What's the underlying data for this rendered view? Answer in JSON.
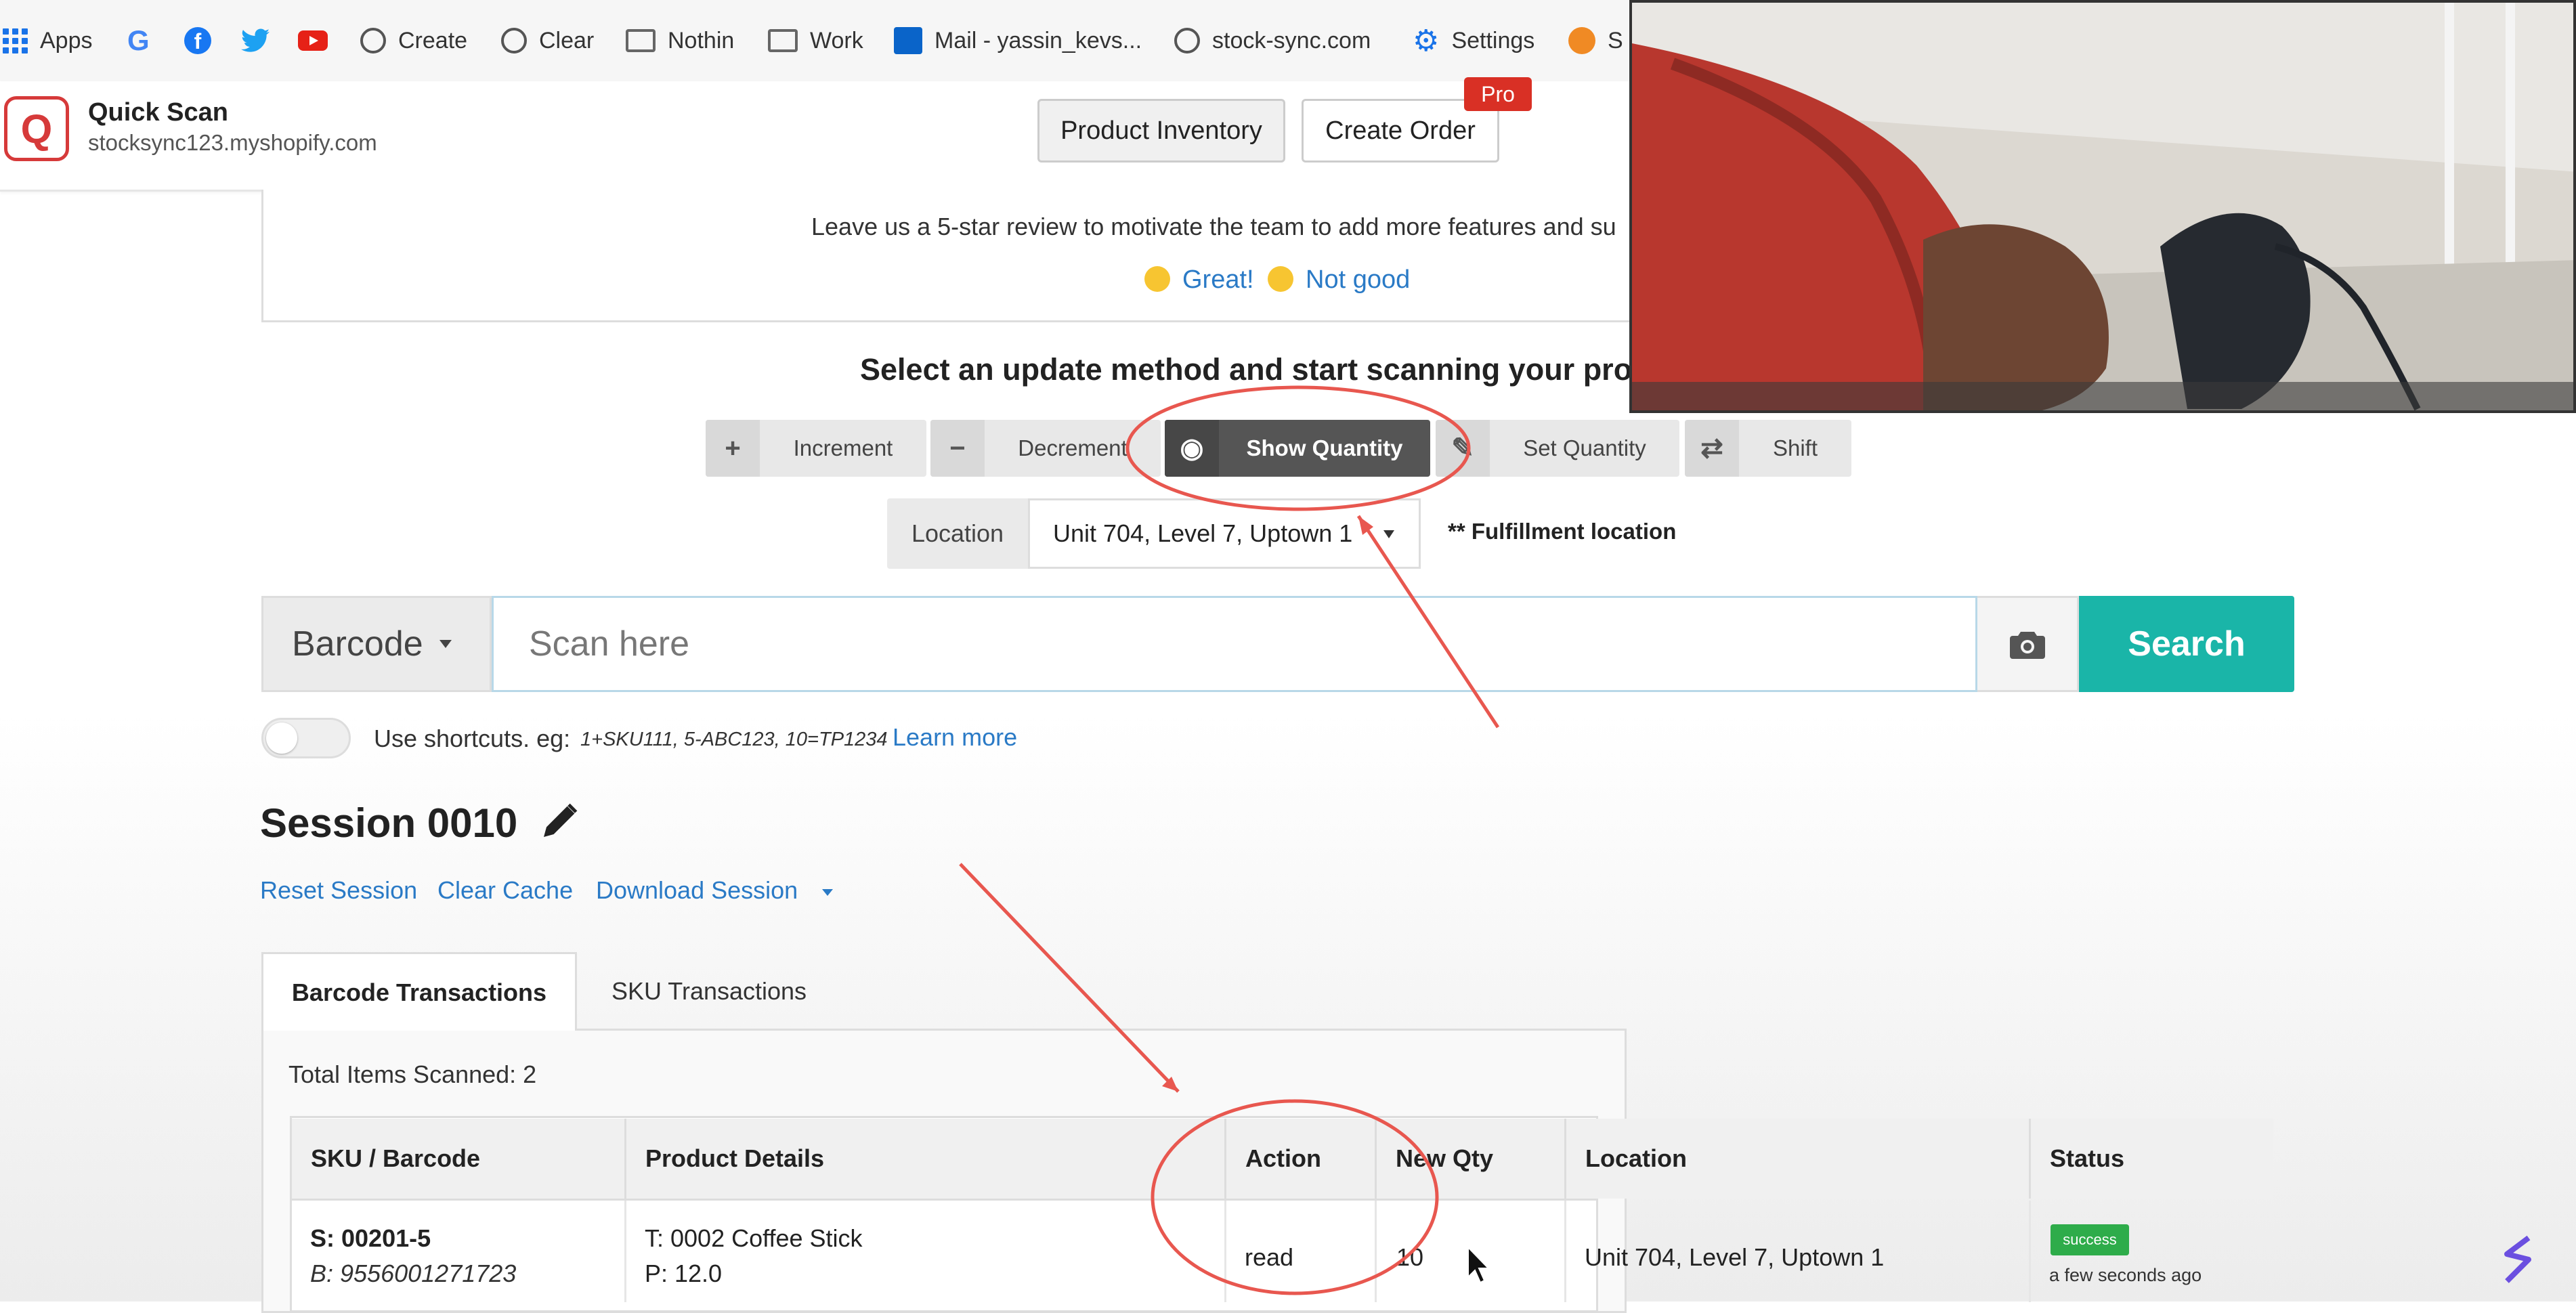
{
  "bookmarks": [
    {
      "label": "Apps",
      "icon": "apps-grid-icon"
    },
    {
      "label": "",
      "icon": "google-icon"
    },
    {
      "label": "",
      "icon": "facebook-icon"
    },
    {
      "label": "",
      "icon": "twitter-icon"
    },
    {
      "label": "",
      "icon": "youtube-icon"
    },
    {
      "label": "Create",
      "icon": "globe-icon"
    },
    {
      "label": "Clear",
      "icon": "globe-icon"
    },
    {
      "label": "Nothin",
      "icon": "folder-icon"
    },
    {
      "label": "Work",
      "icon": "folder-icon"
    },
    {
      "label": "Mail - yassin_kevs...",
      "icon": "outlook-icon"
    },
    {
      "label": "stock-sync.com",
      "icon": "globe-icon"
    },
    {
      "label": "Settings",
      "icon": "gear-icon"
    },
    {
      "label": "S",
      "icon": "orange-circle-icon"
    }
  ],
  "app": {
    "title": "Quick Scan",
    "domain": "stocksync123.myshopify.com",
    "logo_letter": "Q",
    "product_inventory_label": "Product Inventory",
    "create_order_label": "Create Order",
    "pro_badge": "Pro"
  },
  "review": {
    "text": "Leave us a 5-star review to motivate the team to add more features and su",
    "great": "Great!",
    "not_good": "Not good"
  },
  "method": {
    "heading": "Select an update method and start scanning your pro",
    "buttons": [
      {
        "label": "Increment",
        "icon": "+"
      },
      {
        "label": "Decrement",
        "icon": "−"
      },
      {
        "label": "Show Quantity",
        "icon": "◉"
      },
      {
        "label": "Set Quantity",
        "icon": "✎"
      },
      {
        "label": "Shift",
        "icon": "⇄"
      }
    ],
    "active": "Show Quantity"
  },
  "location": {
    "label": "Location",
    "selected": "Unit 704, Level 7, Uptown 1",
    "note": "** Fulfillment location"
  },
  "search": {
    "type_label": "Barcode",
    "placeholder": "Scan here",
    "button_label": "Search"
  },
  "shortcuts": {
    "label": "Use shortcuts. eg:",
    "example": "1+SKU111, 5-ABC123, 10=TP1234",
    "learn_more": "Learn more"
  },
  "session": {
    "title": "Session 0010",
    "reset": "Reset Session",
    "clear_cache": "Clear Cache",
    "download": "Download Session"
  },
  "tabs": {
    "barcode": "Barcode Transactions",
    "sku": "SKU Transactions"
  },
  "table": {
    "total_label": "Total Items Scanned: 2",
    "headers": [
      "SKU / Barcode",
      "Product Details",
      "Action",
      "New Qty",
      "Location",
      "Status"
    ],
    "rows": [
      {
        "sku": "S: 00201-5",
        "barcode": "B: 9556001271723",
        "title": "T: 0002 Coffee Stick",
        "price": "P: 12.0",
        "action": "read",
        "new_qty": "10",
        "location": "Unit 704, Level 7, Uptown 1",
        "status": "success",
        "time": "a few seconds ago"
      }
    ]
  },
  "colors": {
    "accent": "#1ab5a8",
    "link": "#2a7ac6",
    "annotation": "#e8574f",
    "success": "#2eac4a",
    "pro": "#d93025"
  }
}
